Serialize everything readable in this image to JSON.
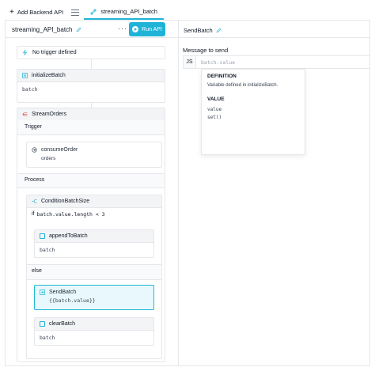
{
  "topbar": {
    "add_label": "Add Backend API",
    "active_tab": "streaming_API_batch"
  },
  "left": {
    "api_name": "streaming_API_batch",
    "more": "···",
    "run_label": "Run API",
    "trigger_label": "No trigger defined",
    "init": {
      "title": "initializeBatch",
      "value": "batch"
    },
    "stream": {
      "title": "StreamOrders",
      "trigger_section": "Trigger",
      "consume": {
        "title": "consumeOrder",
        "value": "orders"
      },
      "process_section": "Process",
      "condition": {
        "title": "ConditionBatchSize",
        "if_kw": "if",
        "expr": "batch.value.length < 3",
        "append": {
          "title": "appendToBatch",
          "value": "batch"
        },
        "else_label": "else",
        "send": {
          "title": "SendBatch",
          "value": "{{batch.value}}"
        },
        "clear": {
          "title": "clearBatch",
          "value": "batch"
        }
      }
    }
  },
  "right": {
    "title": "SendBatch",
    "msg_label": "Message to send",
    "js_label": "JS",
    "msg_value": "batch.value",
    "popup": {
      "definition_heading": "DEFINITION",
      "definition_text": "Variable defined in initializeBatch.",
      "value_heading": "VALUE",
      "options": [
        "value",
        "set()"
      ]
    }
  },
  "colors": {
    "accent": "#1fb3d8",
    "border": "#e5e7eb",
    "header_bg": "#f3f4f6",
    "selected_bg": "#e8f8fc"
  }
}
